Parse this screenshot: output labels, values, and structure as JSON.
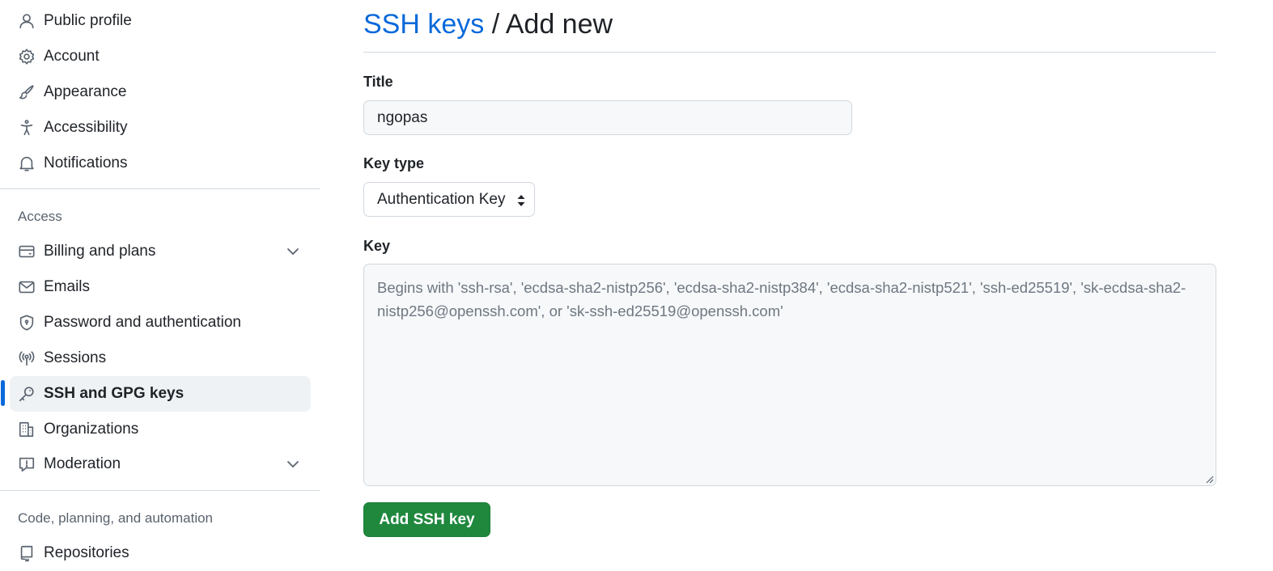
{
  "sidebar": {
    "items_top": [
      {
        "label": "Public profile",
        "icon": "person-icon"
      },
      {
        "label": "Account",
        "icon": "gear-icon"
      },
      {
        "label": "Appearance",
        "icon": "paintbrush-icon"
      },
      {
        "label": "Accessibility",
        "icon": "accessibility-icon"
      },
      {
        "label": "Notifications",
        "icon": "bell-icon"
      }
    ],
    "access_heading": "Access",
    "items_access": [
      {
        "label": "Billing and plans",
        "icon": "credit-card-icon",
        "expandable": true
      },
      {
        "label": "Emails",
        "icon": "mail-icon"
      },
      {
        "label": "Password and authentication",
        "icon": "shield-lock-icon"
      },
      {
        "label": "Sessions",
        "icon": "broadcast-icon"
      },
      {
        "label": "SSH and GPG keys",
        "icon": "key-icon",
        "active": true
      },
      {
        "label": "Organizations",
        "icon": "organization-icon"
      },
      {
        "label": "Moderation",
        "icon": "report-icon",
        "expandable": true
      }
    ],
    "code_heading": "Code, planning, and automation",
    "items_code": [
      {
        "label": "Repositories",
        "icon": "repo-icon"
      }
    ]
  },
  "main": {
    "breadcrumb_link": "SSH keys",
    "breadcrumb_separator": " / ",
    "breadcrumb_current": "Add new",
    "title_label": "Title",
    "title_value": "ngopas",
    "key_type_label": "Key type",
    "key_type_selected": "Authentication Key",
    "key_label": "Key",
    "key_placeholder": "Begins with 'ssh-rsa', 'ecdsa-sha2-nistp256', 'ecdsa-sha2-nistp384', 'ecdsa-sha2-nistp521', 'ssh-ed25519', 'sk-ecdsa-sha2-nistp256@openssh.com', or 'sk-ssh-ed25519@openssh.com'",
    "submit_label": "Add SSH key"
  },
  "colors": {
    "accent": "#0969da",
    "primary_button": "#1f883d",
    "active_nav_bg": "#eff2f5"
  }
}
